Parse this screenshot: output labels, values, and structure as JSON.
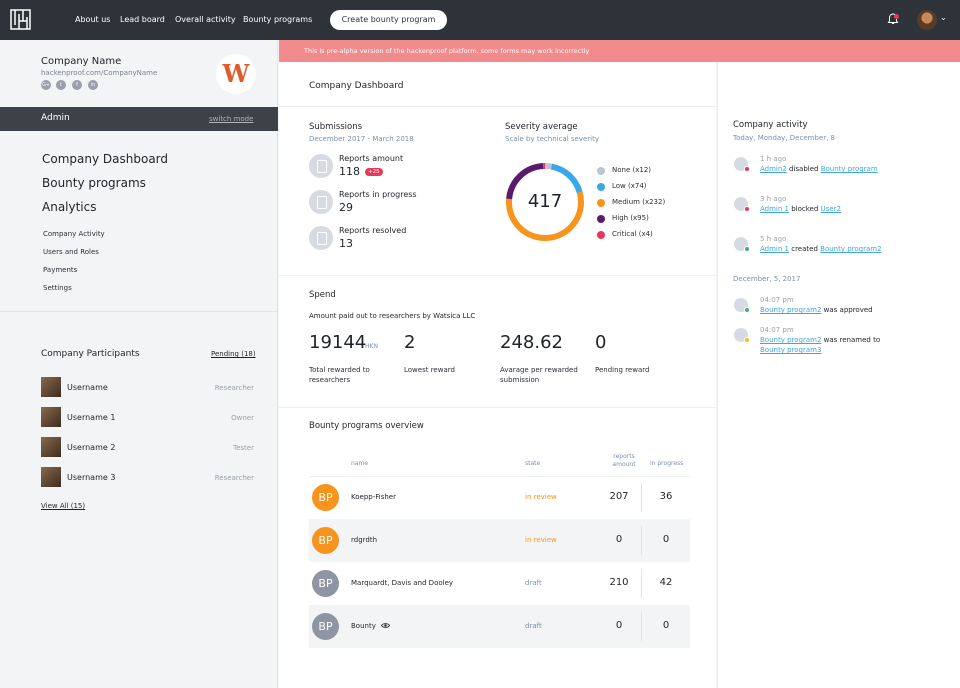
{
  "topbar": {
    "nav": [
      "About us",
      "Lead board",
      "Overall activity",
      "Bounty programs"
    ],
    "create_button": "Create bounty program"
  },
  "alert": {
    "text": "This is pre-alpha version of the hackenproof platform, some forms may work incorrectly"
  },
  "sidebar": {
    "company_name": "Company Name",
    "company_url": "hackenproof.com/CompanyName",
    "social": [
      "G+",
      "t",
      "f",
      "in"
    ],
    "brand_letter": "W",
    "mode": "Admin",
    "switch_mode": "switch mode",
    "main_menu": [
      "Company Dashboard",
      "Bounty programs",
      "Analytics"
    ],
    "sub_menu": [
      "Company Activity",
      "Users and Roles",
      "Payments",
      "Settings"
    ],
    "participants_title": "Company Participants",
    "pending_link": "Pending (18)",
    "participants": [
      {
        "name": "Username",
        "role": "Researcher"
      },
      {
        "name": "Username 1",
        "role": "Owner"
      },
      {
        "name": "Username 2",
        "role": "Tester"
      },
      {
        "name": "Username 3",
        "role": "Researcher"
      }
    ],
    "view_all": "View All (15)"
  },
  "dashboard": {
    "title": "Company Dashboard",
    "submissions": {
      "title": "Submissions",
      "range": "December 2017 - March 2018",
      "items": [
        {
          "label": "Reports amount",
          "value": "118",
          "badge": "+25"
        },
        {
          "label": "Reports in progress",
          "value": "29"
        },
        {
          "label": "Reports resolved",
          "value": "13"
        }
      ]
    },
    "severity": {
      "title": "Severity average",
      "subtitle": "Scale by technical severity",
      "total": "417",
      "legend": [
        {
          "label": "None (x12)",
          "count": 12,
          "color": "#b9c6d6"
        },
        {
          "label": "Low (x74)",
          "count": 74,
          "color": "#3aa7e6"
        },
        {
          "label": "Medium (x232)",
          "count": 232,
          "color": "#f7941d"
        },
        {
          "label": "High (x95)",
          "count": 95,
          "color": "#5a1a6e"
        },
        {
          "label": "Critical (x4)",
          "count": 4,
          "color": "#e6385a"
        }
      ]
    },
    "spend": {
      "title": "Spend",
      "subtitle": "Amount paid out to researchers by Watsica LLC",
      "stats": [
        {
          "value": "19144",
          "unit": "HKN",
          "label": "Total rewarded to researchers"
        },
        {
          "value": "2",
          "label": "Lowest reward"
        },
        {
          "value": "248.62",
          "label": "Avarage per rewarded submission"
        },
        {
          "value": "0",
          "label": "Pending reward"
        }
      ]
    },
    "programs": {
      "title": "Bounty programs overview",
      "headers": {
        "name": "name",
        "state": "state",
        "reports": "reports amount",
        "progress": "in progress"
      },
      "rows": [
        {
          "avatar": "BP",
          "name": "Koepp-Fisher",
          "state": "in review",
          "reports": "207",
          "progress": "36",
          "color": "#f7941d"
        },
        {
          "avatar": "BP",
          "name": "rdgrdth",
          "state": "in review",
          "reports": "0",
          "progress": "0",
          "color": "#f7941d"
        },
        {
          "avatar": "BP",
          "name": "Marquardt, Davis and Dooley",
          "state": "draft",
          "reports": "210",
          "progress": "42",
          "color": "#8f96a3"
        },
        {
          "avatar": "BP",
          "name": "Bounty",
          "state": "draft",
          "reports": "0",
          "progress": "0",
          "color": "#8f96a3"
        }
      ]
    }
  },
  "activity": {
    "title": "Company activity",
    "groups": [
      {
        "date": "Today, Monday, December, 8",
        "items": [
          {
            "time": "1 h ago",
            "actor": "Admin2",
            "action": "disabled",
            "target": "Bounty program",
            "dot": "#e6385a"
          },
          {
            "time": "3 h ago",
            "actor": "Admin 1",
            "action": "blocked",
            "target": "User2",
            "dot": "#e6385a"
          },
          {
            "time": "5 h ago",
            "actor": "Admin 1",
            "action": "created",
            "target": "Bounty program2",
            "dot": "#3cb371"
          }
        ]
      },
      {
        "date": "December, 5, 2017",
        "items": [
          {
            "time": "04:07 pm",
            "actor": "Bounty program2",
            "action": "was approved",
            "dot": "#3cb371"
          },
          {
            "time": "04:07 pm",
            "actor": "Bounty program2",
            "action": "was renamed to",
            "target": "Bounty program3",
            "dot": "#f0c419"
          }
        ]
      }
    ]
  }
}
